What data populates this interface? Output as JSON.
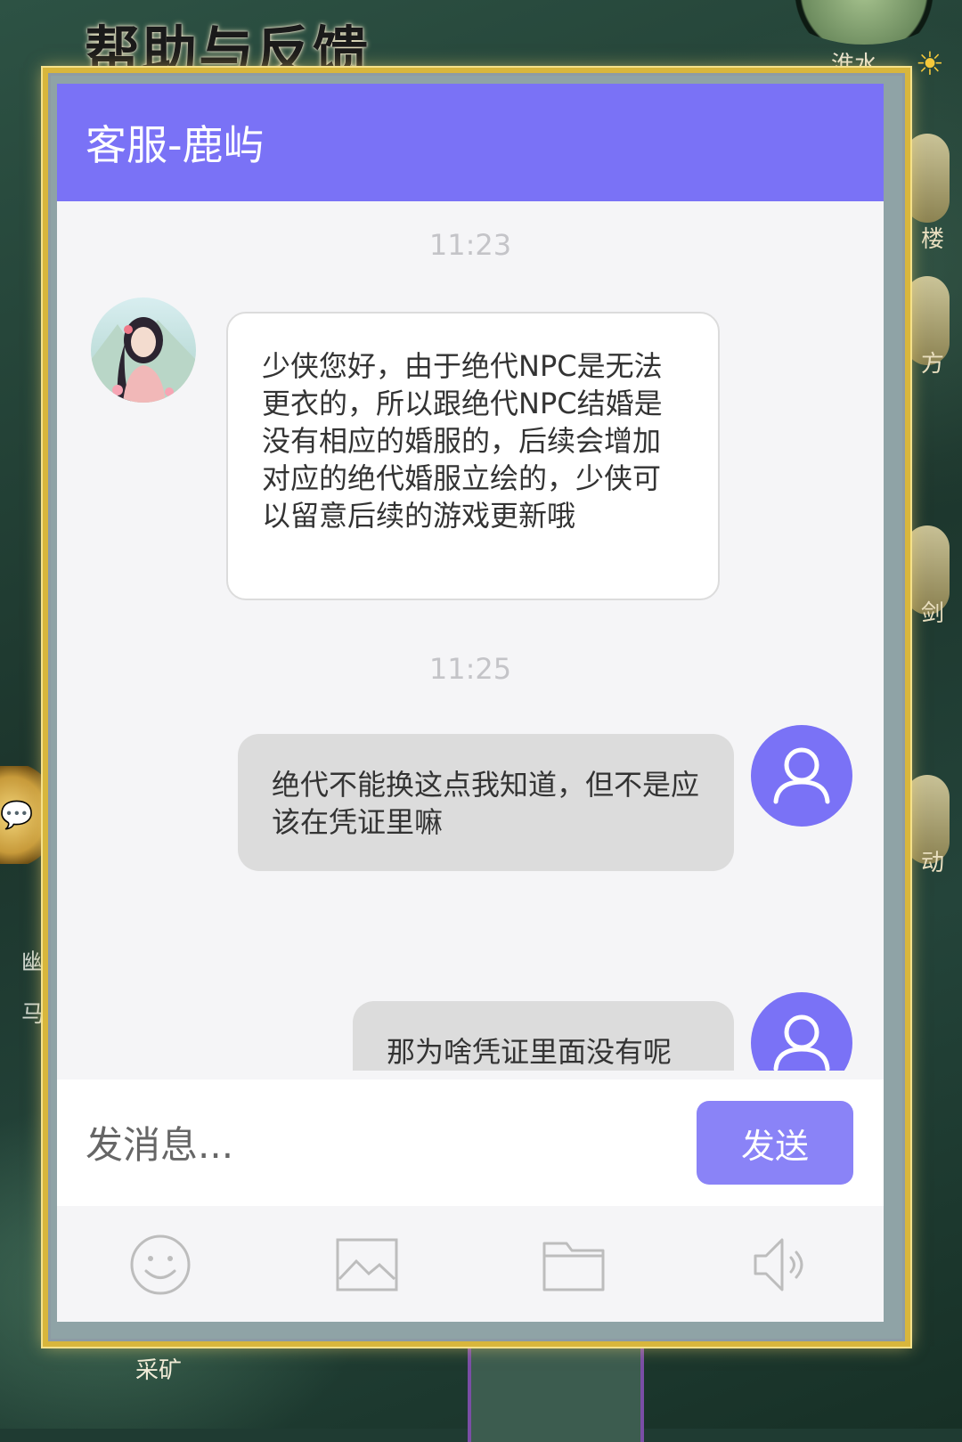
{
  "background": {
    "title": "帮助与反馈",
    "top_right_label": "淮水",
    "side_labels": [
      "楼",
      "方",
      "剑",
      "动"
    ],
    "left_labels": [
      "幽",
      "马"
    ],
    "bottom_label": "采矿"
  },
  "header": {
    "title": "客服-鹿屿",
    "color": "#7a72f6"
  },
  "chat": {
    "messages": [
      {
        "time": "11:23"
      },
      {
        "sender": "agent",
        "avatar": "agent-portrait",
        "text": "少侠您好，由于绝代NPC是无法更衣的，所以跟绝代NPC结婚是没有相应的婚服的，后续会增加对应的绝代婚服立绘的，少侠可以留意后续的游戏更新哦"
      },
      {
        "time": "11:25"
      },
      {
        "sender": "user",
        "avatar": "user-icon",
        "text": "绝代不能换这点我知道，但不是应该在凭证里嘛"
      },
      {
        "sender": "user",
        "avatar": "user-icon",
        "text": "那为啥凭证里面没有呢"
      }
    ]
  },
  "input": {
    "placeholder": "发消息...",
    "value": ""
  },
  "send_button": {
    "label": "发送",
    "color": "#8a83f7"
  },
  "toolbar": {
    "icons": [
      "emoji-icon",
      "image-icon",
      "folder-icon",
      "speaker-icon"
    ]
  }
}
